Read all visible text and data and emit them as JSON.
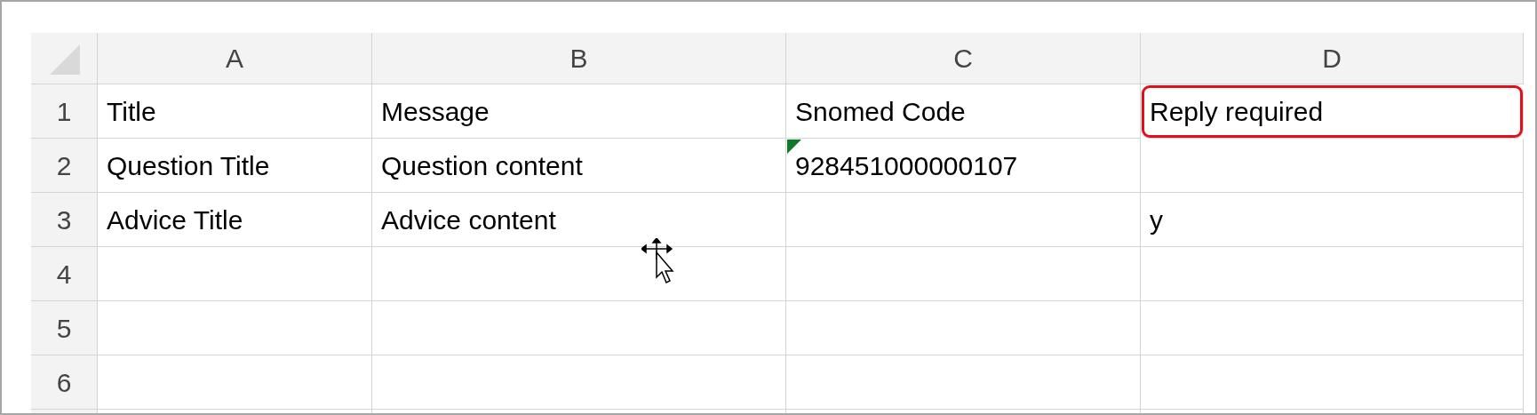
{
  "columns": [
    "A",
    "B",
    "C",
    "D"
  ],
  "rows": [
    {
      "number": "1",
      "cells": [
        {
          "text": "Title",
          "highlighted": false,
          "error_marker": false
        },
        {
          "text": "Message",
          "highlighted": false,
          "error_marker": false
        },
        {
          "text": "Snomed Code",
          "highlighted": false,
          "error_marker": false
        },
        {
          "text": "Reply required",
          "highlighted": true,
          "error_marker": false
        }
      ]
    },
    {
      "number": "2",
      "cells": [
        {
          "text": "Question Title",
          "highlighted": false,
          "error_marker": false
        },
        {
          "text": "Question content",
          "highlighted": false,
          "error_marker": false
        },
        {
          "text": "928451000000107",
          "highlighted": false,
          "error_marker": true
        },
        null
      ]
    },
    {
      "number": "3",
      "cells": [
        {
          "text": "Advice Title",
          "highlighted": false,
          "error_marker": false
        },
        {
          "text": "Advice content",
          "highlighted": false,
          "error_marker": false
        },
        null,
        {
          "text": "y",
          "highlighted": false,
          "error_marker": false
        }
      ]
    },
    {
      "number": "4",
      "cells": [
        null,
        null,
        null,
        null
      ]
    },
    {
      "number": "5",
      "cells": [
        null,
        null,
        null,
        null
      ]
    },
    {
      "number": "6",
      "cells": [
        null,
        null,
        null,
        null
      ]
    }
  ]
}
